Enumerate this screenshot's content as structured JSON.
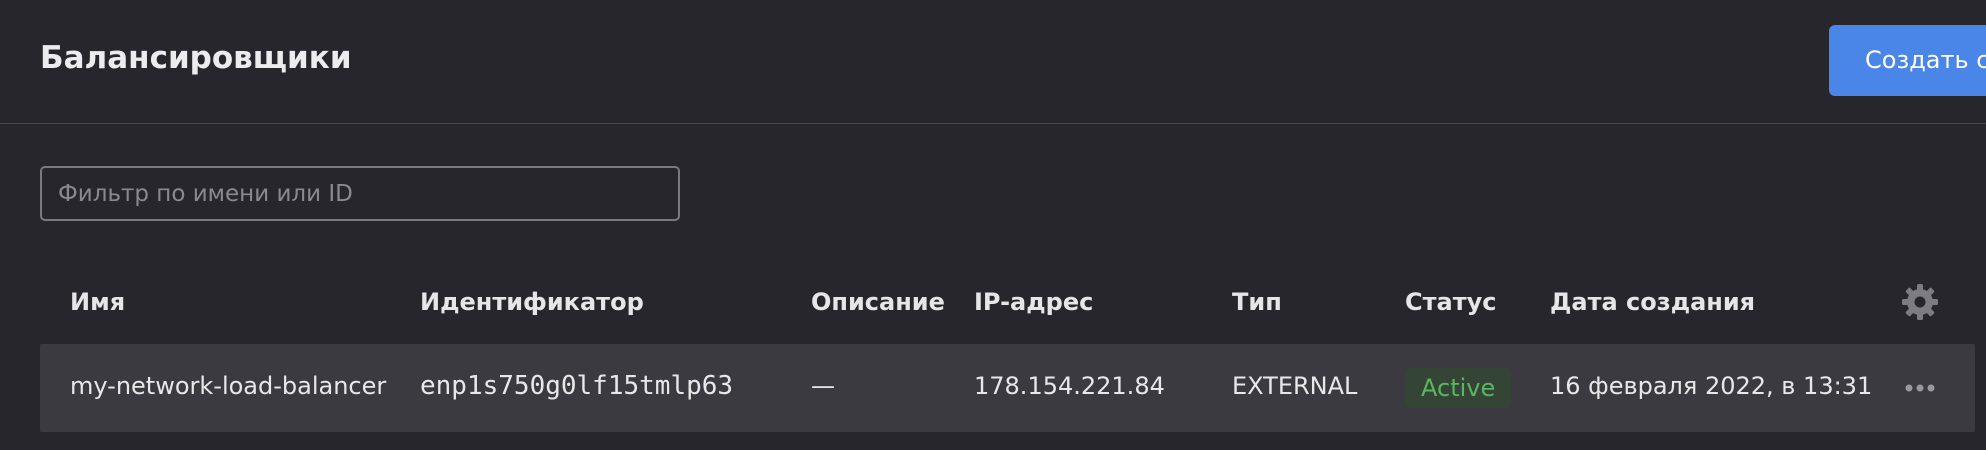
{
  "header": {
    "title": "Балансировщики",
    "create_button_label": "Создать сетевой балансировщик"
  },
  "filter": {
    "placeholder": "Фильтр по имени или ID",
    "value": ""
  },
  "table": {
    "columns": [
      "Имя",
      "Идентификатор",
      "Описание",
      "IP-адрес",
      "Тип",
      "Статус",
      "Дата создания"
    ],
    "settings_icon": "gear-icon",
    "rows": [
      {
        "name": "my-network-load-balancer",
        "id": "enp1s750g0lf15tmlp63",
        "description": "—",
        "ip": "178.154.221.84",
        "type": "EXTERNAL",
        "status": "Active",
        "created": "16 февраля 2022, в 13:31",
        "actions_icon": "more-icon"
      }
    ]
  },
  "colors": {
    "background": "#27262d",
    "row_background": "#3b3a41",
    "accent": "#4a86e8",
    "status_active": "#5ab563"
  }
}
